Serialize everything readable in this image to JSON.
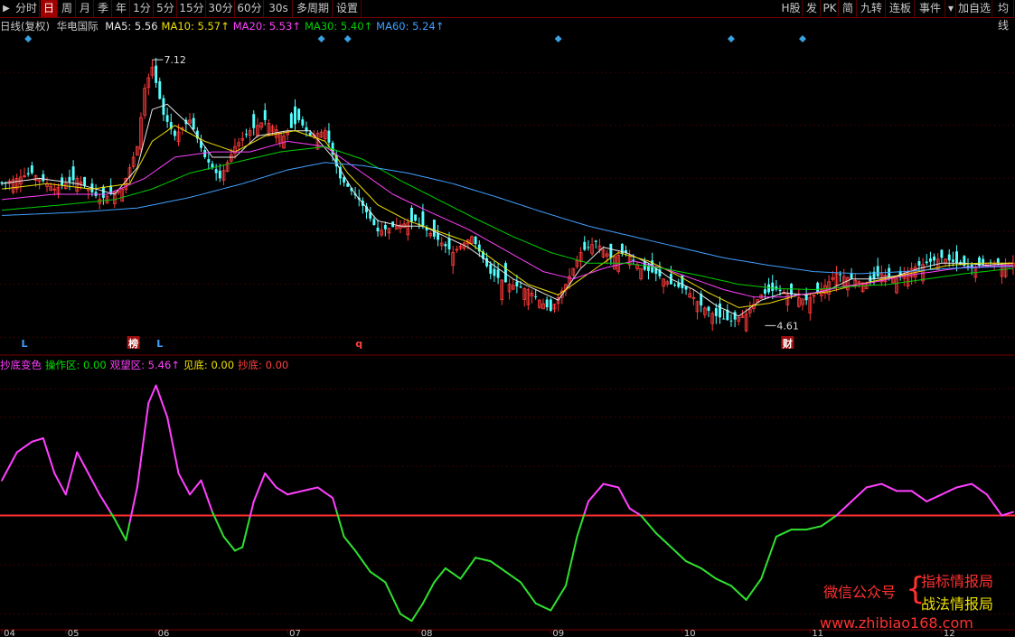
{
  "toolbar": {
    "left_items": [
      "分时",
      "日",
      "周",
      "月",
      "季",
      "年",
      "1分",
      "5分",
      "15分",
      "30分",
      "60分",
      "30s",
      "多周期",
      "设置"
    ],
    "active_item": "日",
    "right_items": [
      "H股",
      "发",
      "PK",
      "简",
      "九转",
      "连板",
      "事件",
      "加自选",
      "均线"
    ]
  },
  "ma_bar": {
    "title": "日线(复权)",
    "stock": "华电国际",
    "ma": [
      {
        "label": "MA5: 5.56",
        "color": "#e8e8e8"
      },
      {
        "label": "MA10: 5.57↑",
        "color": "#f0e000"
      },
      {
        "label": "MA20: 5.53↑",
        "color": "#ff40ff"
      },
      {
        "label": "MA30: 5.40↑",
        "color": "#00d000"
      },
      {
        "label": "MA60: 5.24↑",
        "color": "#40a0ff"
      }
    ]
  },
  "indicator_bar": {
    "items": [
      {
        "label": "抄底变色",
        "color": "#ff40ff"
      },
      {
        "label": "操作区: 0.00",
        "color": "#00e000"
      },
      {
        "label": "观望区: 5.46↑",
        "color": "#ff40ff"
      },
      {
        "label": "见底: 0.00",
        "color": "#f0e000"
      },
      {
        "label": "抄底: 0.00",
        "color": "#ff4040"
      }
    ]
  },
  "chart_data": {
    "type": "candlestick",
    "ylim": [
      4.4,
      7.3
    ],
    "high_label": "7.12",
    "low_label": "4.61",
    "x_tick_labels": [
      "04",
      "05",
      "06",
      "07",
      "08",
      "09",
      "10",
      "11",
      "12"
    ],
    "x_tick_index": [
      0,
      17,
      41,
      76,
      111,
      146,
      181,
      215,
      250
    ],
    "n_bars": 270,
    "close_path": [
      [
        0,
        5.95
      ],
      [
        8,
        6.05
      ],
      [
        14,
        5.9
      ],
      [
        20,
        6.0
      ],
      [
        26,
        5.8
      ],
      [
        32,
        5.9
      ],
      [
        36,
        6.3
      ],
      [
        38,
        6.85
      ],
      [
        40,
        7.05
      ],
      [
        43,
        6.6
      ],
      [
        46,
        6.4
      ],
      [
        50,
        6.55
      ],
      [
        54,
        6.2
      ],
      [
        58,
        6.0
      ],
      [
        62,
        6.3
      ],
      [
        66,
        6.45
      ],
      [
        70,
        6.55
      ],
      [
        75,
        6.4
      ],
      [
        79,
        6.55
      ],
      [
        82,
        6.4
      ],
      [
        86,
        6.45
      ],
      [
        90,
        6.0
      ],
      [
        95,
        5.8
      ],
      [
        100,
        5.5
      ],
      [
        105,
        5.55
      ],
      [
        110,
        5.6
      ],
      [
        115,
        5.45
      ],
      [
        120,
        5.3
      ],
      [
        125,
        5.45
      ],
      [
        130,
        5.1
      ],
      [
        135,
        5.0
      ],
      [
        140,
        4.95
      ],
      [
        146,
        4.75
      ],
      [
        150,
        5.0
      ],
      [
        154,
        5.3
      ],
      [
        158,
        5.4
      ],
      [
        162,
        5.25
      ],
      [
        166,
        5.3
      ],
      [
        170,
        5.15
      ],
      [
        174,
        5.1
      ],
      [
        178,
        5.0
      ],
      [
        182,
        4.95
      ],
      [
        186,
        4.8
      ],
      [
        190,
        4.7
      ],
      [
        194,
        4.65
      ],
      [
        198,
        4.72
      ],
      [
        202,
        4.9
      ],
      [
        206,
        4.95
      ],
      [
        210,
        4.9
      ],
      [
        214,
        4.85
      ],
      [
        218,
        4.95
      ],
      [
        222,
        5.1
      ],
      [
        226,
        5.05
      ],
      [
        230,
        5.0
      ],
      [
        234,
        5.1
      ],
      [
        238,
        5.05
      ],
      [
        242,
        5.15
      ],
      [
        246,
        5.2
      ],
      [
        250,
        5.25
      ],
      [
        254,
        5.2
      ],
      [
        258,
        5.15
      ],
      [
        262,
        5.2
      ],
      [
        269,
        5.2
      ]
    ],
    "ma_series": [
      {
        "name": "MA5",
        "color": "#e8e8e8",
        "path": [
          [
            0,
            5.95
          ],
          [
            10,
            6.0
          ],
          [
            20,
            5.95
          ],
          [
            30,
            5.85
          ],
          [
            36,
            6.1
          ],
          [
            40,
            6.65
          ],
          [
            44,
            6.7
          ],
          [
            50,
            6.5
          ],
          [
            56,
            6.2
          ],
          [
            62,
            6.2
          ],
          [
            68,
            6.4
          ],
          [
            76,
            6.45
          ],
          [
            82,
            6.45
          ],
          [
            88,
            6.2
          ],
          [
            94,
            5.85
          ],
          [
            100,
            5.6
          ],
          [
            106,
            5.55
          ],
          [
            112,
            5.55
          ],
          [
            118,
            5.45
          ],
          [
            124,
            5.35
          ],
          [
            130,
            5.2
          ],
          [
            136,
            5.05
          ],
          [
            142,
            4.95
          ],
          [
            148,
            4.85
          ],
          [
            154,
            5.15
          ],
          [
            160,
            5.35
          ],
          [
            166,
            5.3
          ],
          [
            172,
            5.2
          ],
          [
            178,
            5.05
          ],
          [
            184,
            4.95
          ],
          [
            190,
            4.8
          ],
          [
            196,
            4.7
          ],
          [
            202,
            4.85
          ],
          [
            208,
            4.92
          ],
          [
            214,
            4.9
          ],
          [
            220,
            4.95
          ],
          [
            226,
            5.05
          ],
          [
            232,
            5.05
          ],
          [
            238,
            5.08
          ],
          [
            244,
            5.15
          ],
          [
            250,
            5.2
          ],
          [
            256,
            5.2
          ],
          [
            262,
            5.18
          ],
          [
            269,
            5.2
          ]
        ]
      },
      {
        "name": "MA10",
        "color": "#f0e000",
        "path": [
          [
            0,
            5.9
          ],
          [
            12,
            5.95
          ],
          [
            24,
            5.9
          ],
          [
            34,
            5.95
          ],
          [
            40,
            6.35
          ],
          [
            46,
            6.5
          ],
          [
            54,
            6.35
          ],
          [
            62,
            6.25
          ],
          [
            70,
            6.4
          ],
          [
            78,
            6.45
          ],
          [
            86,
            6.35
          ],
          [
            92,
            6.05
          ],
          [
            100,
            5.75
          ],
          [
            108,
            5.6
          ],
          [
            116,
            5.5
          ],
          [
            124,
            5.4
          ],
          [
            132,
            5.2
          ],
          [
            140,
            5.0
          ],
          [
            148,
            4.9
          ],
          [
            156,
            5.1
          ],
          [
            164,
            5.3
          ],
          [
            172,
            5.22
          ],
          [
            180,
            5.08
          ],
          [
            188,
            4.92
          ],
          [
            196,
            4.78
          ],
          [
            204,
            4.82
          ],
          [
            212,
            4.9
          ],
          [
            220,
            4.93
          ],
          [
            228,
            5.0
          ],
          [
            236,
            5.06
          ],
          [
            244,
            5.12
          ],
          [
            252,
            5.18
          ],
          [
            260,
            5.2
          ],
          [
            269,
            5.2
          ]
        ]
      },
      {
        "name": "MA20",
        "color": "#ff40ff",
        "path": [
          [
            0,
            5.8
          ],
          [
            14,
            5.85
          ],
          [
            28,
            5.85
          ],
          [
            38,
            6.0
          ],
          [
            46,
            6.2
          ],
          [
            56,
            6.25
          ],
          [
            66,
            6.25
          ],
          [
            76,
            6.35
          ],
          [
            86,
            6.3
          ],
          [
            94,
            6.1
          ],
          [
            104,
            5.85
          ],
          [
            114,
            5.68
          ],
          [
            124,
            5.52
          ],
          [
            134,
            5.32
          ],
          [
            144,
            5.12
          ],
          [
            152,
            5.05
          ],
          [
            160,
            5.15
          ],
          [
            168,
            5.22
          ],
          [
            176,
            5.15
          ],
          [
            184,
            5.05
          ],
          [
            192,
            4.95
          ],
          [
            200,
            4.88
          ],
          [
            208,
            4.88
          ],
          [
            216,
            4.92
          ],
          [
            224,
            4.98
          ],
          [
            232,
            5.02
          ],
          [
            240,
            5.08
          ],
          [
            248,
            5.12
          ],
          [
            256,
            5.16
          ],
          [
            269,
            5.18
          ]
        ]
      },
      {
        "name": "MA30",
        "color": "#00d000",
        "path": [
          [
            0,
            5.7
          ],
          [
            16,
            5.75
          ],
          [
            30,
            5.8
          ],
          [
            40,
            5.9
          ],
          [
            50,
            6.05
          ],
          [
            62,
            6.15
          ],
          [
            74,
            6.25
          ],
          [
            86,
            6.3
          ],
          [
            96,
            6.18
          ],
          [
            106,
            5.98
          ],
          [
            116,
            5.8
          ],
          [
            126,
            5.62
          ],
          [
            136,
            5.45
          ],
          [
            146,
            5.3
          ],
          [
            156,
            5.2
          ],
          [
            166,
            5.2
          ],
          [
            176,
            5.15
          ],
          [
            186,
            5.08
          ],
          [
            196,
            5.0
          ],
          [
            206,
            4.96
          ],
          [
            216,
            4.95
          ],
          [
            226,
            4.98
          ],
          [
            236,
            5.0
          ],
          [
            246,
            5.05
          ],
          [
            256,
            5.1
          ],
          [
            269,
            5.15
          ]
        ]
      },
      {
        "name": "MA60",
        "color": "#40a0ff",
        "path": [
          [
            0,
            5.65
          ],
          [
            20,
            5.68
          ],
          [
            36,
            5.72
          ],
          [
            50,
            5.82
          ],
          [
            64,
            5.95
          ],
          [
            76,
            6.08
          ],
          [
            86,
            6.15
          ],
          [
            96,
            6.12
          ],
          [
            108,
            6.05
          ],
          [
            120,
            5.95
          ],
          [
            132,
            5.82
          ],
          [
            144,
            5.68
          ],
          [
            156,
            5.55
          ],
          [
            168,
            5.45
          ],
          [
            180,
            5.35
          ],
          [
            192,
            5.25
          ],
          [
            204,
            5.18
          ],
          [
            216,
            5.12
          ],
          [
            228,
            5.1
          ],
          [
            240,
            5.12
          ],
          [
            252,
            5.15
          ],
          [
            269,
            5.17
          ]
        ]
      }
    ],
    "markers": [
      {
        "index": 6,
        "text": "L",
        "color": "#40a0ff"
      },
      {
        "index": 35,
        "text": "榜",
        "color": "#ffffff",
        "bg": "#a01010"
      },
      {
        "index": 42,
        "text": "L",
        "color": "#40a0ff"
      },
      {
        "index": 95,
        "text": "q",
        "color": "#ff4040"
      },
      {
        "index": 209,
        "text": "财",
        "color": "#ffffff",
        "bg": "#a01010"
      }
    ],
    "diamonds": [
      7,
      85,
      92,
      148,
      194,
      213
    ],
    "indicator": {
      "name": "抄底变色",
      "ylim": [
        -1.6,
        2.0
      ],
      "baseline": 0,
      "baseline_color": "#ff3030",
      "above_color": "#ff40ff",
      "below_color": "#30e030",
      "path": [
        [
          0,
          0.5
        ],
        [
          4,
          0.9
        ],
        [
          8,
          1.05
        ],
        [
          11,
          1.1
        ],
        [
          14,
          0.6
        ],
        [
          17,
          0.3
        ],
        [
          20,
          0.9
        ],
        [
          23,
          0.6
        ],
        [
          26,
          0.3
        ],
        [
          30,
          -0.05
        ],
        [
          33,
          -0.35
        ],
        [
          36,
          0.4
        ],
        [
          39,
          1.6
        ],
        [
          41,
          1.85
        ],
        [
          44,
          1.4
        ],
        [
          47,
          0.6
        ],
        [
          50,
          0.3
        ],
        [
          53,
          0.5
        ],
        [
          56,
          0.05
        ],
        [
          59,
          -0.3
        ],
        [
          62,
          -0.5
        ],
        [
          64,
          -0.45
        ],
        [
          67,
          0.2
        ],
        [
          70,
          0.6
        ],
        [
          73,
          0.4
        ],
        [
          76,
          0.3
        ],
        [
          80,
          0.35
        ],
        [
          84,
          0.4
        ],
        [
          88,
          0.25
        ],
        [
          91,
          -0.3
        ],
        [
          94,
          -0.5
        ],
        [
          98,
          -0.8
        ],
        [
          102,
          -0.95
        ],
        [
          106,
          -1.4
        ],
        [
          109,
          -1.5
        ],
        [
          112,
          -1.25
        ],
        [
          115,
          -0.95
        ],
        [
          118,
          -0.75
        ],
        [
          122,
          -0.9
        ],
        [
          126,
          -0.6
        ],
        [
          130,
          -0.65
        ],
        [
          134,
          -0.8
        ],
        [
          138,
          -0.95
        ],
        [
          142,
          -1.25
        ],
        [
          146,
          -1.35
        ],
        [
          150,
          -1.0
        ],
        [
          153,
          -0.3
        ],
        [
          156,
          0.2
        ],
        [
          160,
          0.45
        ],
        [
          164,
          0.4
        ],
        [
          167,
          0.1
        ],
        [
          170,
          0.0
        ],
        [
          174,
          -0.25
        ],
        [
          178,
          -0.45
        ],
        [
          182,
          -0.65
        ],
        [
          186,
          -0.75
        ],
        [
          190,
          -0.9
        ],
        [
          194,
          -1.0
        ],
        [
          198,
          -1.2
        ],
        [
          202,
          -0.9
        ],
        [
          206,
          -0.3
        ],
        [
          210,
          -0.2
        ],
        [
          214,
          -0.2
        ],
        [
          218,
          -0.15
        ],
        [
          222,
          0.0
        ],
        [
          226,
          0.2
        ],
        [
          230,
          0.4
        ],
        [
          234,
          0.45
        ],
        [
          238,
          0.35
        ],
        [
          242,
          0.35
        ],
        [
          246,
          0.2
        ],
        [
          250,
          0.3
        ],
        [
          254,
          0.4
        ],
        [
          258,
          0.45
        ],
        [
          262,
          0.3
        ],
        [
          266,
          0.0
        ],
        [
          269,
          0.05
        ]
      ]
    }
  },
  "watermark": {
    "line1_left": "微信公众号",
    "line1_right": "指标情报局",
    "line2_right": "战法情报局",
    "url": "www.zhibiao168.com"
  }
}
